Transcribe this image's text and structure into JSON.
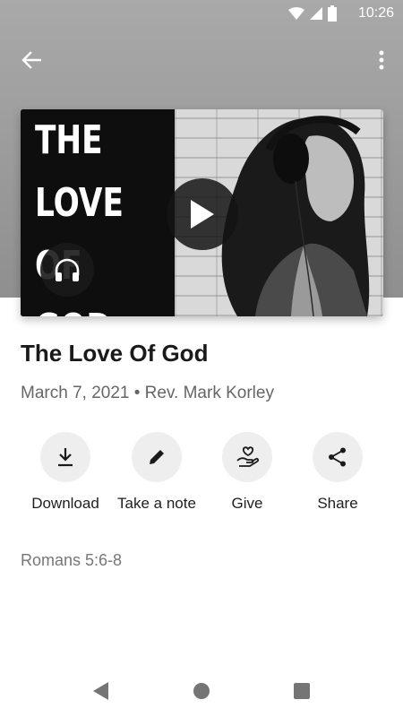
{
  "status_bar": {
    "time": "10:26",
    "icons": [
      "wifi-icon",
      "signal-icon",
      "battery-icon"
    ]
  },
  "app_bar": {
    "back_icon": "arrow-left-icon",
    "more_icon": "more-vert-icon"
  },
  "hero": {
    "artwork_text": "THE\nLOVE OF\nGOD.",
    "play_icon": "play-icon",
    "audio_icon": "headphones-icon"
  },
  "sermon": {
    "title": "The Love Of God",
    "meta": "March 7, 2021 • Rev. Mark Korley",
    "scripture": "Romans 5:6-8"
  },
  "actions": [
    {
      "label": "Download",
      "icon": "download-icon"
    },
    {
      "label": "Take a note",
      "icon": "pencil-icon"
    },
    {
      "label": "Give",
      "icon": "hand-heart-icon"
    },
    {
      "label": "Share",
      "icon": "share-icon"
    }
  ],
  "nav_bar": {
    "icons": [
      "back-triangle-icon",
      "home-circle-icon",
      "recents-square-icon"
    ]
  },
  "colors": {
    "header_gray": "#9a9a9a",
    "action_circle": "#eeeeee",
    "meta_text": "#666666"
  }
}
